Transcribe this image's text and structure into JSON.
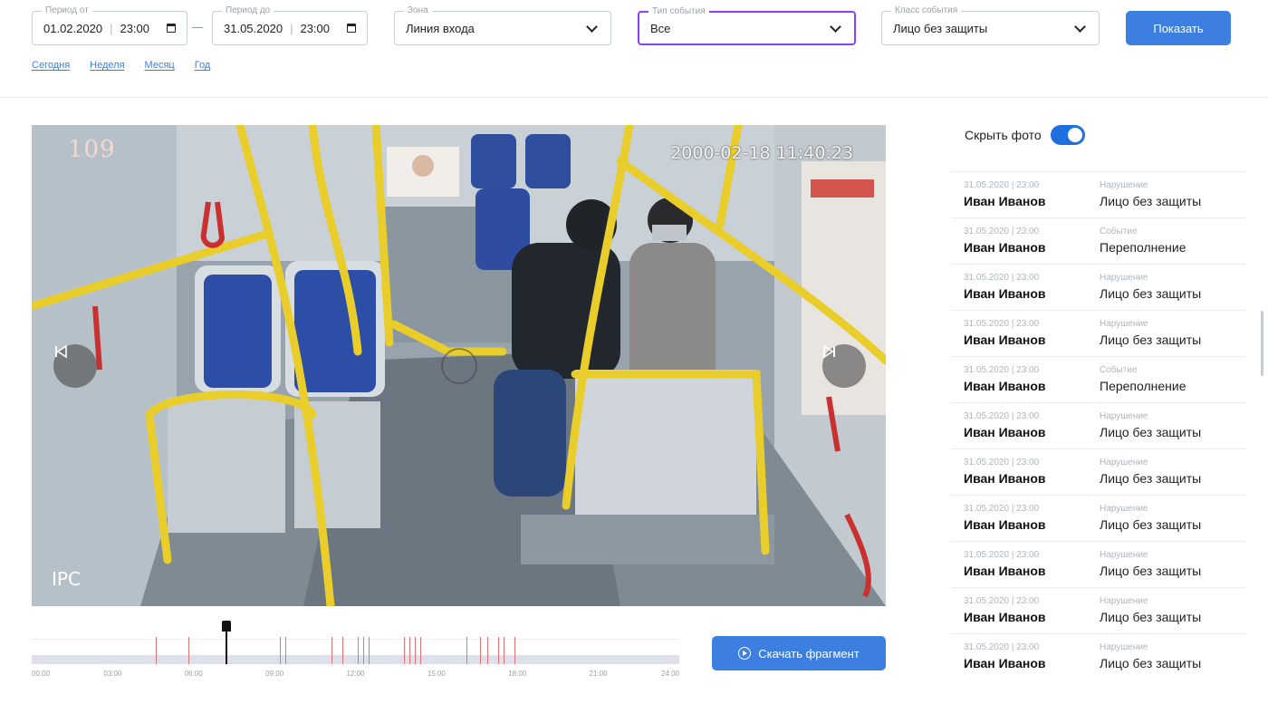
{
  "filters": {
    "period_from": {
      "label": "Период от",
      "date": "01.02.2020",
      "time": "23:00"
    },
    "period_to": {
      "label": "Период до",
      "date": "31.05.2020",
      "time": "23:00"
    },
    "zone": {
      "label": "Зона",
      "value": "Линия входа"
    },
    "event_type": {
      "label": "Тип события",
      "value": "Все"
    },
    "event_class": {
      "label": "Класс события",
      "value": "Лицо без защиты"
    },
    "show_label": "Показать",
    "quick_ranges": [
      "Сегодня",
      "Неделя",
      "Месяц",
      "Год"
    ]
  },
  "video": {
    "camera_number": "109",
    "timestamp": "2000-02-18 11:40:23",
    "brand": "IPC"
  },
  "timeline": {
    "ticks": [
      "00:00",
      "03:00",
      "06:00",
      "09:00",
      "12:00",
      "15:00",
      "18:00",
      "21:00",
      "24:00"
    ],
    "cursor_hour": 7.2,
    "event_hours": [
      4.6,
      5.8,
      9.2,
      9.4,
      11.1,
      11.5,
      12.1,
      12.3,
      12.5,
      13.8,
      14.0,
      14.2,
      14.4,
      16.1,
      16.6,
      16.9,
      17.3,
      17.5,
      17.9
    ]
  },
  "download_label": "Скачать фрагмент",
  "hide_photo": {
    "label": "Скрыть фото",
    "on": true
  },
  "events": [
    {
      "ts": "31.05.2020  |  23:00",
      "name": "Иван Иванов",
      "type": "Нарушение",
      "class": "Лицо без защиты"
    },
    {
      "ts": "31.05.2020  |  23:00",
      "name": "Иван Иванов",
      "type": "Событие",
      "class": "Переполнение"
    },
    {
      "ts": "31.05.2020  |  23:00",
      "name": "Иван Иванов",
      "type": "Нарушение",
      "class": "Лицо без защиты"
    },
    {
      "ts": "31.05.2020  |  23:00",
      "name": "Иван Иванов",
      "type": "Нарушение",
      "class": "Лицо без защиты"
    },
    {
      "ts": "31.05.2020  |  23:00",
      "name": "Иван Иванов",
      "type": "Событие",
      "class": "Переполнение"
    },
    {
      "ts": "31.05.2020  |  23:00",
      "name": "Иван Иванов",
      "type": "Нарушение",
      "class": "Лицо без защиты"
    },
    {
      "ts": "31.05.2020  |  23:00",
      "name": "Иван Иванов",
      "type": "Нарушение",
      "class": "Лицо без защиты"
    },
    {
      "ts": "31.05.2020  |  23:00",
      "name": "Иван Иванов",
      "type": "Нарушение",
      "class": "Лицо без защиты"
    },
    {
      "ts": "31.05.2020  |  23:00",
      "name": "Иван Иванов",
      "type": "Нарушение",
      "class": "Лицо без защиты"
    },
    {
      "ts": "31.05.2020  |  23:00",
      "name": "Иван Иванов",
      "type": "Нарушение",
      "class": "Лицо без защиты"
    },
    {
      "ts": "31.05.2020  |  23:00",
      "name": "Иван Иванов",
      "type": "Нарушение",
      "class": "Лицо без защиты"
    }
  ],
  "colors": {
    "accent": "#3d7fe0",
    "focus": "#8a3ffc",
    "timeline_mark": "#e57373",
    "toggle": "#1f6fe0"
  }
}
